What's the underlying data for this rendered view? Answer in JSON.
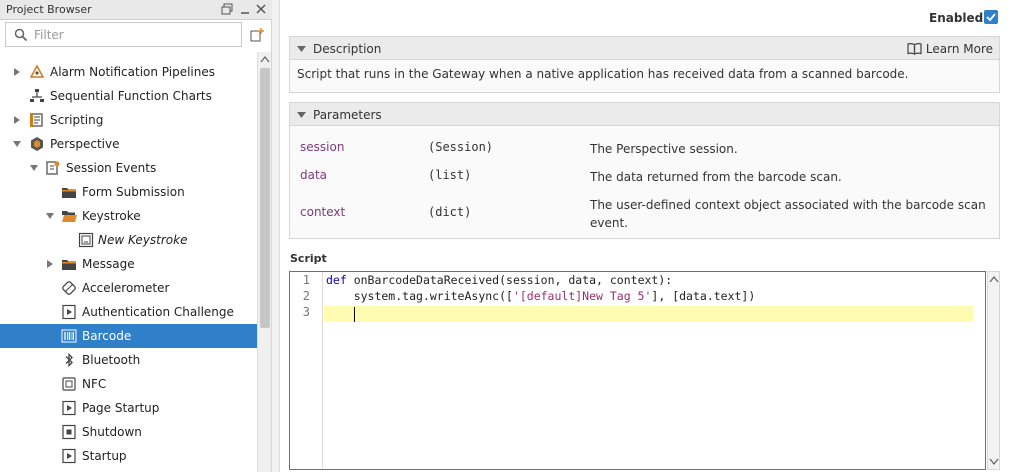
{
  "project_browser": {
    "title": "Project Browser",
    "filter_placeholder": "Filter",
    "tree": [
      {
        "label": "Alarm Notification Pipelines",
        "icon": "pipeline-icon",
        "arrow": "collapsed"
      },
      {
        "label": "Sequential Function Charts",
        "icon": "sfc-icon",
        "arrow": "none"
      },
      {
        "label": "Scripting",
        "icon": "script-icon",
        "arrow": "collapsed"
      },
      {
        "label": "Perspective",
        "icon": "perspective-icon",
        "arrow": "expanded"
      },
      {
        "label": "Session Events",
        "icon": "session-events-icon",
        "arrow": "expanded"
      },
      {
        "label": "Form Submission",
        "icon": "folder-icon",
        "arrow": "none"
      },
      {
        "label": "Keystroke",
        "icon": "folder-open-icon",
        "arrow": "expanded"
      },
      {
        "label": "New Keystroke",
        "icon": "keystroke-icon",
        "arrow": "none"
      },
      {
        "label": "Message",
        "icon": "folder-icon",
        "arrow": "collapsed"
      },
      {
        "label": "Accelerometer",
        "icon": "accelerometer-icon",
        "arrow": "none"
      },
      {
        "label": "Authentication Challenge",
        "icon": "auth-icon",
        "arrow": "none"
      },
      {
        "label": "Barcode",
        "icon": "barcode-icon",
        "arrow": "none"
      },
      {
        "label": "Bluetooth",
        "icon": "bluetooth-icon",
        "arrow": "none"
      },
      {
        "label": "NFC",
        "icon": "nfc-icon",
        "arrow": "none"
      },
      {
        "label": "Page Startup",
        "icon": "page-startup-icon",
        "arrow": "none"
      },
      {
        "label": "Shutdown",
        "icon": "shutdown-icon",
        "arrow": "none"
      },
      {
        "label": "Startup",
        "icon": "startup-icon",
        "arrow": "none"
      }
    ]
  },
  "editor": {
    "enabled_label": "Enabled",
    "description": {
      "title": "Description",
      "learn_more": "Learn More",
      "text": "Script that runs in the Gateway when a native application has received data from a scanned barcode."
    },
    "parameters": {
      "title": "Parameters",
      "rows": [
        {
          "name": "session",
          "type": "(Session)",
          "desc": "The Perspective session."
        },
        {
          "name": "data",
          "type": "(list)",
          "desc": "The data returned from the barcode scan."
        },
        {
          "name": "context",
          "type": "(dict)",
          "desc": "The user-defined context object associated with the barcode scan event."
        }
      ]
    },
    "script": {
      "label": "Script",
      "line_numbers": [
        "1",
        "2",
        "3"
      ],
      "line1": {
        "kw": "def",
        "rest": " onBarcodeDataReceived(session, data, context):"
      },
      "line2": {
        "pre": "    system.tag.writeAsync([",
        "str": "'[default]New Tag 5'",
        "post": "], [data.text])"
      },
      "line3": ""
    }
  },
  "colors": {
    "selection": "#2f7fc9",
    "param_name": "#7d3b7d",
    "keyword": "#0000c8",
    "string": "#9b2f6e",
    "active_line": "#fffbb0"
  }
}
